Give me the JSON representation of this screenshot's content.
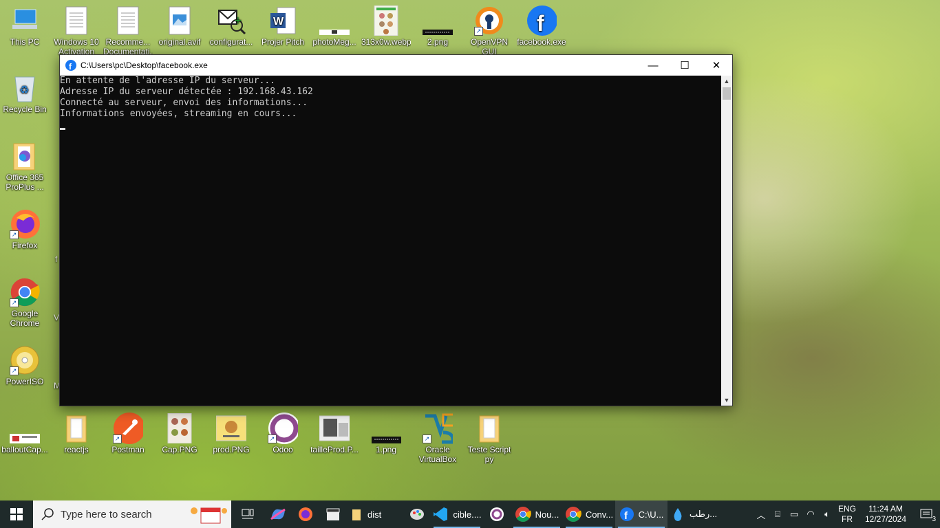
{
  "desktop_icons": [
    {
      "label": "This PC",
      "icon": "computer-icon"
    },
    {
      "label": "Windows 10 Activation",
      "icon": "text-document-icon"
    },
    {
      "label": "Recomme... Documentati...",
      "icon": "text-document-icon"
    },
    {
      "label": "original.avif",
      "icon": "image-file-icon"
    },
    {
      "label": "configurat...",
      "icon": "config-envelope-icon"
    },
    {
      "label": "Projer Pitch",
      "icon": "word-document-icon"
    },
    {
      "label": "photoMeg...",
      "icon": "image-thumbnail-icon"
    },
    {
      "label": "313x0w.webp",
      "icon": "image-thumbnail-icon"
    },
    {
      "label": "2.png",
      "icon": "image-thumbnail-icon"
    },
    {
      "label": "OpenVPN GUI",
      "icon": "openvpn-icon"
    },
    {
      "label": "facebook.exe",
      "icon": "facebook-icon"
    },
    {
      "label": "Recycle Bin",
      "icon": "recycle-bin-icon"
    },
    {
      "label": "Office 365 ProPlus ...",
      "icon": "office-folder-icon"
    },
    {
      "label": "Firefox",
      "icon": "firefox-icon"
    },
    {
      "label": "Google Chrome",
      "icon": "chrome-icon"
    },
    {
      "label": "PowerISO",
      "icon": "poweriso-icon"
    },
    {
      "label": "balloutCap...",
      "icon": "image-thumbnail-icon"
    },
    {
      "label": "reactjs",
      "icon": "folder-icon"
    },
    {
      "label": "Postman",
      "icon": "postman-icon"
    },
    {
      "label": "Cap.PNG",
      "icon": "image-thumbnail-icon"
    },
    {
      "label": "prod.PNG",
      "icon": "image-thumbnail-icon"
    },
    {
      "label": "Odoo",
      "icon": "odoo-icon"
    },
    {
      "label": "tailleProd.P...",
      "icon": "image-thumbnail-icon"
    },
    {
      "label": "1.png",
      "icon": "image-thumbnail-icon"
    },
    {
      "label": "Oracle VirtualBox",
      "icon": "virtualbox-icon"
    },
    {
      "label": "Teste Script py",
      "icon": "folder-icon"
    }
  ],
  "partial_labels": {
    "f": "f",
    "v": "V",
    "m": "M"
  },
  "console": {
    "title": "C:\\Users\\pc\\Desktop\\facebook.exe",
    "lines": [
      "En attente de l'adresse IP du serveur...",
      "Adresse IP du serveur détectée : 192.168.43.162",
      "Connecté au serveur, envoi des informations...",
      "Informations envoyées, streaming en cours..."
    ],
    "minimize": "—",
    "maximize": "☐",
    "close": "✕"
  },
  "taskbar": {
    "search_placeholder": "Type here to search",
    "items": [
      {
        "label": "",
        "icon": "task-view-icon"
      },
      {
        "label": "",
        "icon": "copilot-icon"
      },
      {
        "label": "",
        "icon": "firefox-icon"
      },
      {
        "label": "",
        "icon": "clapperboard-icon"
      },
      {
        "label": "dist",
        "icon": "folder-icon"
      },
      {
        "label": "",
        "icon": "paint-icon"
      },
      {
        "label": "cible....",
        "icon": "vscode-icon"
      },
      {
        "label": "",
        "icon": "odoo-icon"
      },
      {
        "label": "Nou...",
        "icon": "chrome-icon"
      },
      {
        "label": "Conv...",
        "icon": "chrome-icon"
      },
      {
        "label": "C:\\U...",
        "icon": "facebook-icon"
      },
      {
        "label": "رطب...",
        "icon": "water-drop-icon"
      }
    ],
    "lang_top": "ENG",
    "lang_bottom": "FR",
    "time": "11:24 AM",
    "date": "12/27/2024",
    "notification_count": "3"
  },
  "colors": {
    "console_bg": "#0c0c0c",
    "console_text": "#cccccc",
    "taskbar_bg": "#1f2a2a",
    "facebook_blue": "#1877f2",
    "active_indicator": "#76b9ed"
  }
}
